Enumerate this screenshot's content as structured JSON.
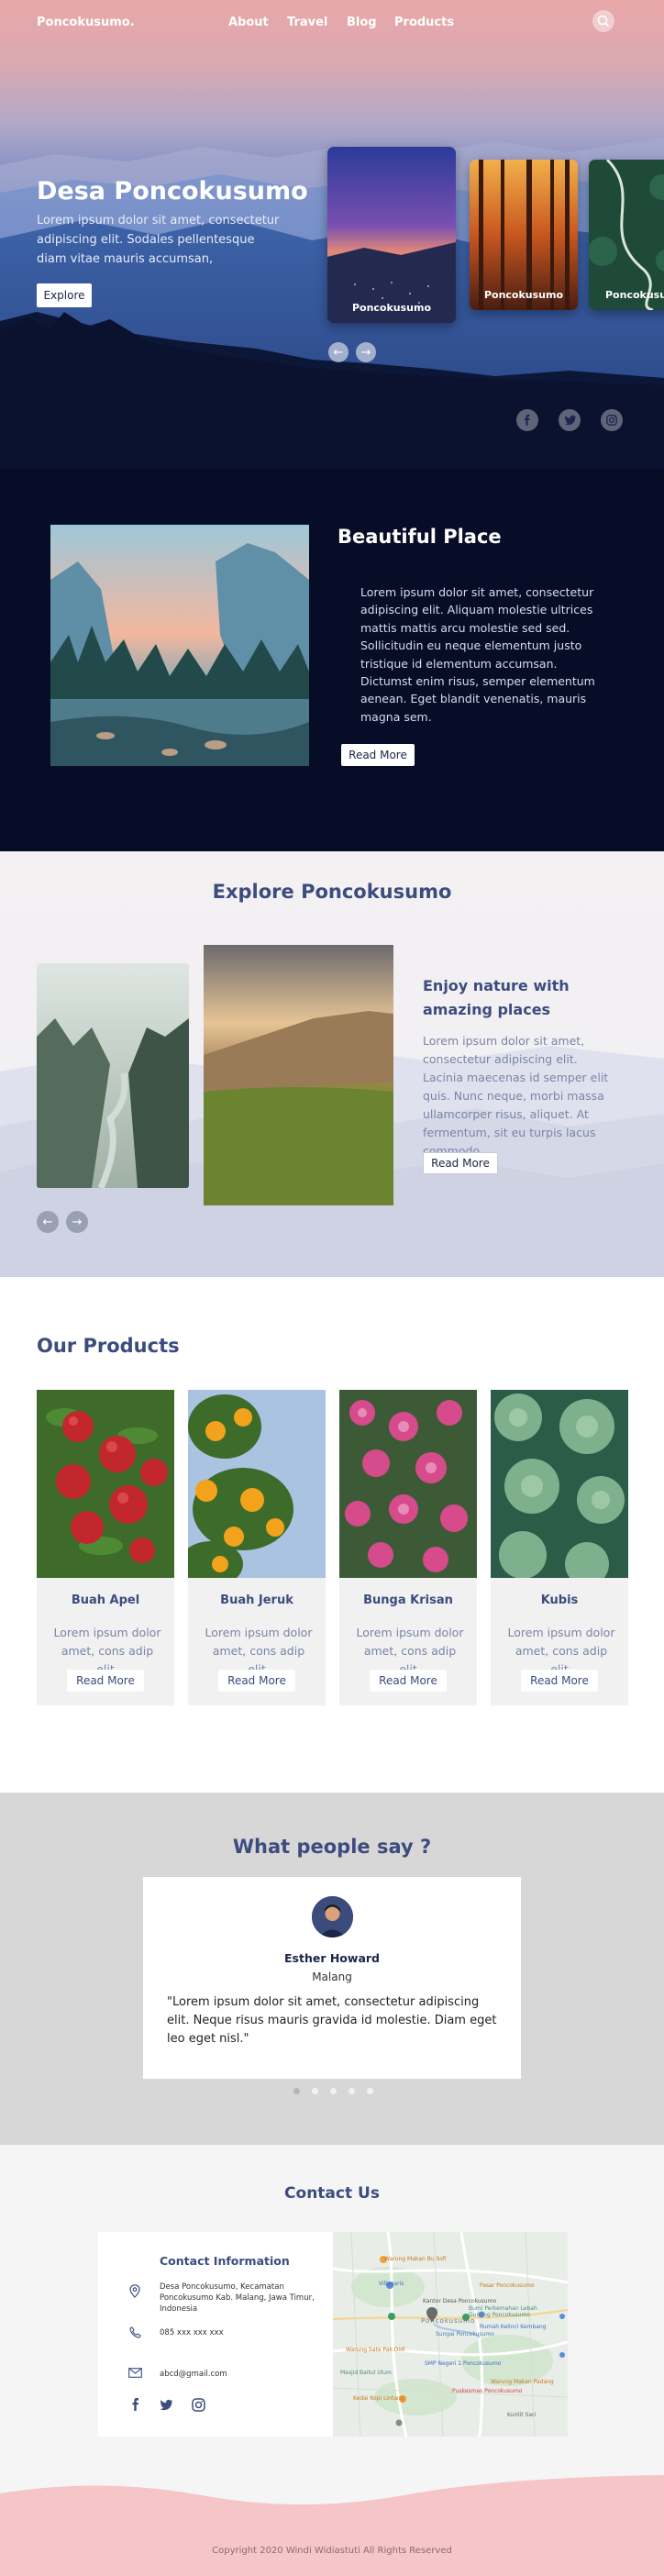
{
  "nav": {
    "logo": "Poncokusumo.",
    "links": [
      "About",
      "Travel",
      "Blog",
      "Products"
    ]
  },
  "hero": {
    "title": "Desa Poncokusumo",
    "description": "Lorem ipsum dolor sit amet, consectetur adipiscing elit. Sodales pellentesque diam vitae mauris accumsan,",
    "button": "Explore",
    "cards": [
      "Poncokusumo",
      "Poncokusumo",
      "Poncokusumo"
    ]
  },
  "place": {
    "title": "Beautiful Place",
    "description": "Lorem ipsum dolor sit amet, consectetur adipiscing elit. Aliquam molestie ultrices mattis mattis arcu molestie sed sed. Sollicitudin eu neque elementum justo tristique id elementum accumsan. Dictumst enim risus, semper elementum aenean. Eget blandit venenatis, mauris magna sem.",
    "button": "Read More"
  },
  "explore": {
    "title": "Explore Poncokusumo",
    "heading": "Enjoy nature with amazing places",
    "description": "Lorem ipsum dolor sit amet, consectetur adipiscing elit.  Lacinia maecenas id semper elit quis. Nunc neque, morbi massa ullamcorper risus, aliquet. At fermentum, sit eu turpis lacus commodo.",
    "button": "Read More"
  },
  "products": {
    "title": "Our Products",
    "items": [
      {
        "name": "Buah Apel",
        "desc": "Lorem ipsum dolor amet, cons adip elit.",
        "button": "Read More"
      },
      {
        "name": "Buah Jeruk",
        "desc": "Lorem ipsum dolor amet, cons adip elit.",
        "button": "Read More"
      },
      {
        "name": "Bunga Krisan",
        "desc": "Lorem ipsum dolor amet, cons adip elit.",
        "button": "Read More"
      },
      {
        "name": "Kubis",
        "desc": "Lorem ipsum dolor amet, cons adip elit.",
        "button": "Read More"
      }
    ]
  },
  "testimonial": {
    "title": "What people say ?",
    "name": "Esther Howard",
    "city": "Malang",
    "quote": "\"Lorem ipsum dolor sit amet, consectetur adipiscing elit. Neque risus mauris gravida id molestie. Diam eget leo eget nisl.\""
  },
  "contact": {
    "title": "Contact Us",
    "heading": "Contact Information",
    "address": "Desa Poncokusumo, Kecamatan Poncokusumo Kab. Malang, Jawa Timur, Indonesia",
    "phone": "085 xxx xxx xxx",
    "email": "abcd@gmail.com",
    "map_labels": [
      "Warung Makan Bu Sofi",
      "Villagaris",
      "Kantor Desa Poncokusumo",
      "Bumi Perkemahan Lebah Gunung Poncokusumo",
      "Rumah Kelinci Kembang",
      "Warung Sate Pak Didi",
      "Sungai Poncokusumo",
      "Kedai Kopi Lintang",
      "Warung Makan Padang",
      "Masjid Baitul Ulum",
      "Kuntit Sari",
      "SMP Negeri 1 Poncokusumo",
      "Puskesmas Poncokusumo",
      "Pasar Poncokusumo",
      "Poncokusumo"
    ]
  },
  "footer": {
    "copyright": "Copyright 2020 Windi Widiastuti All Rights Reserved"
  },
  "colors": {
    "navy": "#070d26",
    "heading": "#3c4c7e",
    "muted": "#7b84a6",
    "footer_wave": "#f6c5c7"
  },
  "icons": [
    "search-icon",
    "arrow-left-icon",
    "arrow-right-icon",
    "facebook-icon",
    "twitter-icon",
    "instagram-icon",
    "location-icon",
    "phone-icon",
    "mail-icon"
  ]
}
